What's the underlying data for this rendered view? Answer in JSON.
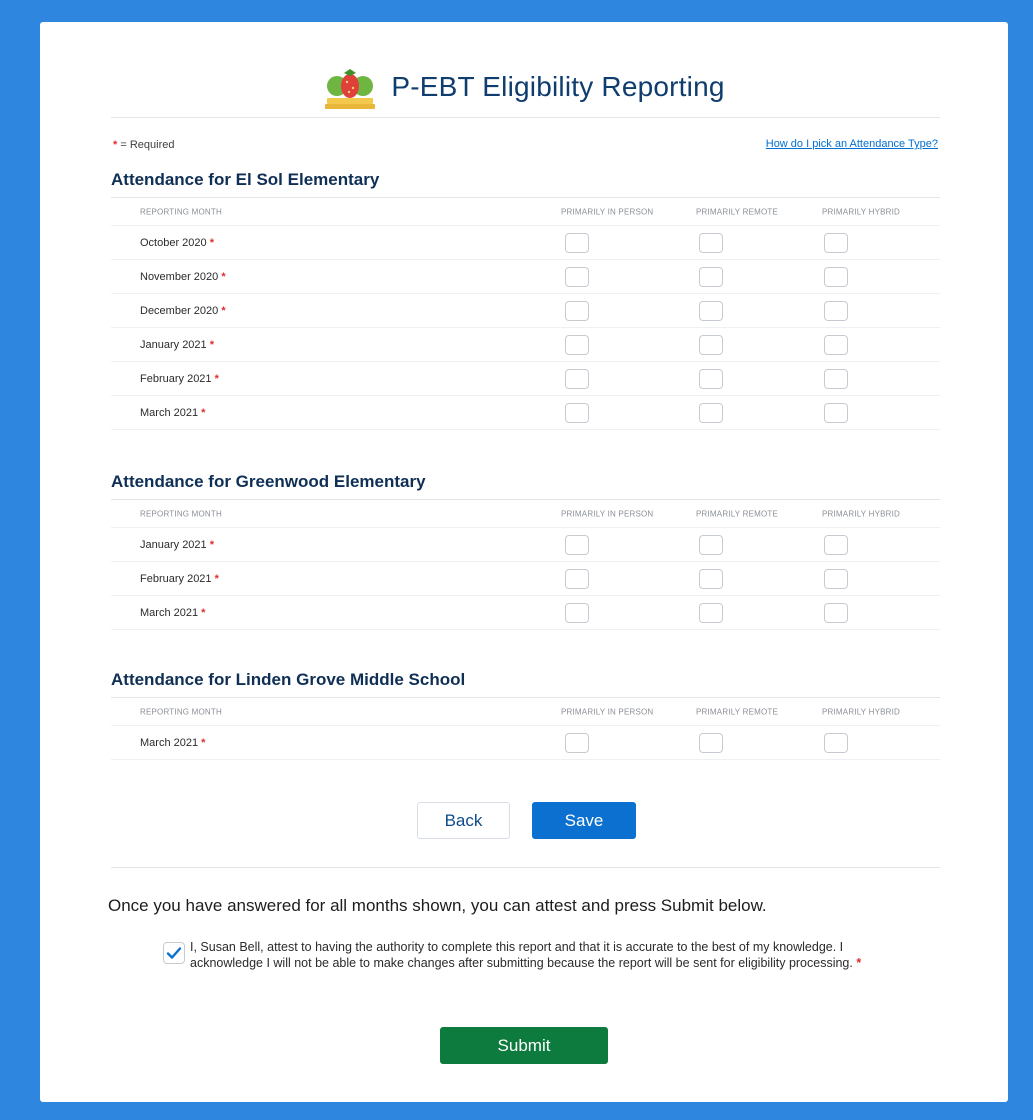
{
  "header": {
    "title": "P-EBT Eligibility Reporting"
  },
  "legend": {
    "star": "*",
    "required_label": "= Required"
  },
  "help_link": "How do I pick an  Attendance Type?",
  "columns": {
    "month": "REPORTING MONTH",
    "in_person": "PRIMARILY IN PERSON",
    "remote": "PRIMARILY REMOTE",
    "hybrid": "PRIMARILY HYBRID"
  },
  "sections": [
    {
      "title": "Attendance for El Sol Elementary",
      "months": [
        "October 2020",
        "November 2020",
        "December 2020",
        "January 2021",
        "February 2021",
        "March 2021"
      ]
    },
    {
      "title": "Attendance for Greenwood Elementary",
      "months": [
        "January 2021",
        "February 2021",
        "March 2021"
      ]
    },
    {
      "title": "Attendance for Linden Grove Middle School",
      "months": [
        "March 2021"
      ]
    }
  ],
  "buttons": {
    "back": "Back",
    "save": "Save",
    "submit": "Submit"
  },
  "attest": {
    "intro": "Once you have answered for all months shown, you can attest and press Submit below.",
    "statement": "I, Susan Bell, attest to having the authority to complete this report and that it is accurate to the best of my knowledge. I acknowledge I will not be able to make changes after submitting because the report will be sent for eligibility processing.",
    "checked": true
  },
  "colors": {
    "accent": "#0b70d0",
    "submit": "#0d7a3e",
    "required": "#e02d2d",
    "background": "#2f86de"
  }
}
